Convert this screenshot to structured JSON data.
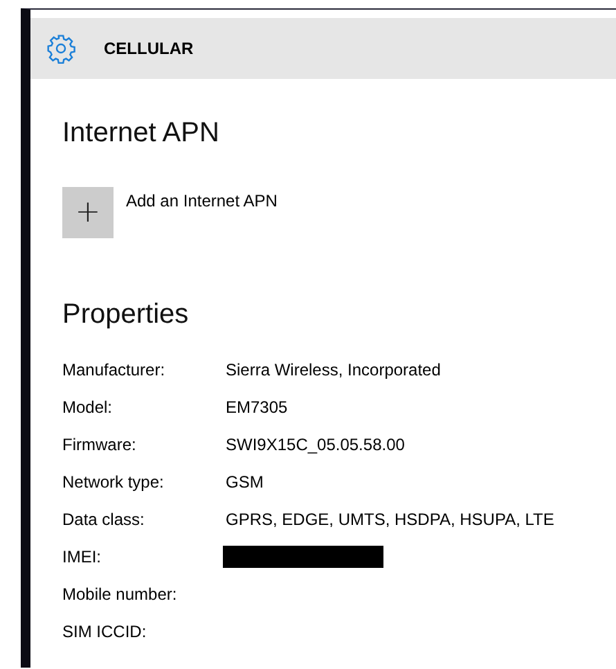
{
  "header": {
    "title": "CELLULAR"
  },
  "internet_apn": {
    "heading": "Internet APN",
    "add_label": "Add an Internet APN",
    "add_icon": "+"
  },
  "properties": {
    "heading": "Properties",
    "rows": [
      {
        "label": "Manufacturer:",
        "value": "Sierra Wireless, Incorporated"
      },
      {
        "label": "Model:",
        "value": "EM7305"
      },
      {
        "label": "Firmware:",
        "value": "SWI9X15C_05.05.58.00"
      },
      {
        "label": "Network type:",
        "value": "GSM"
      },
      {
        "label": "Data class:",
        "value": "GPRS, EDGE, UMTS, HSDPA, HSUPA, LTE"
      },
      {
        "label": "IMEI:",
        "redacted": true
      },
      {
        "label": "Mobile number:"
      },
      {
        "label": "SIM ICCID:"
      }
    ]
  }
}
